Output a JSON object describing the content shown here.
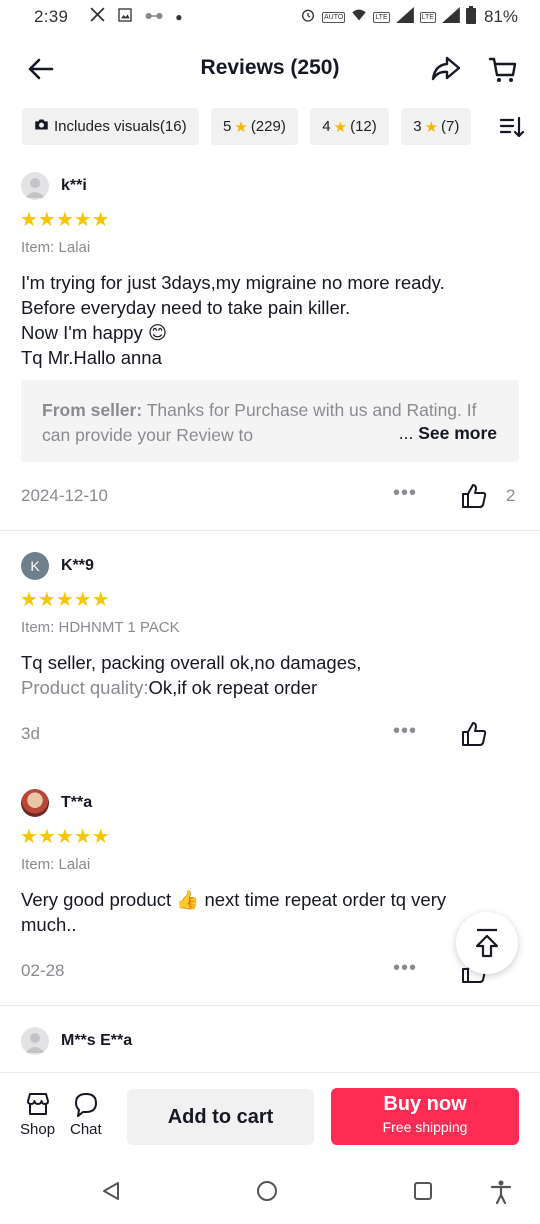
{
  "status_bar": {
    "time": "2:39",
    "battery": "81%",
    "lte1": "LTE",
    "lte2": "LTE"
  },
  "header": {
    "title": "Reviews (250)"
  },
  "filters": [
    {
      "label": "Includes visuals(16)",
      "icon": "camera-icon"
    },
    {
      "num": "5",
      "count": "(229)"
    },
    {
      "num": "4",
      "count": "(12)"
    },
    {
      "num": "3",
      "count": "(7)"
    }
  ],
  "reviews": [
    {
      "user": "k**i",
      "stars": "★★★★★",
      "item": "Item: Lalai",
      "text_lines": [
        "I'm trying for just 3days,my migraine no more ready.",
        "Before everyday need to take pain killer.",
        "Now I'm happy 😊",
        "Tq Mr.Hallo anna"
      ],
      "seller_label": "From seller:",
      "seller_text": "Thanks for Purchase with us and Rating. If can provide your Review to",
      "see_more": "See more",
      "date": "2024-12-10",
      "likes": "2"
    },
    {
      "user": "K**9",
      "avatar_letter": "K",
      "stars": "★★★★★",
      "item": "Item: HDHNMT 1 PACK",
      "text_line1": "Tq seller, packing overall ok,no damages,",
      "quality_label": "Product quality:",
      "quality_value": "Ok,if ok repeat order",
      "date": "3d"
    },
    {
      "user": "T**a",
      "stars": "★★★★★",
      "item": "Item: Lalai",
      "text_lines": [
        "Very good product 👍 next time repeat order tq very",
        "much.."
      ],
      "date": "02-28"
    },
    {
      "user": "M**s E**a"
    }
  ],
  "bottom_bar": {
    "shop": "Shop",
    "chat": "Chat",
    "add_to_cart": "Add to cart",
    "buy_now": "Buy now",
    "free_shipping": "Free shipping"
  },
  "colors": {
    "accent": "#fe2c55",
    "star": "#f7c600"
  }
}
